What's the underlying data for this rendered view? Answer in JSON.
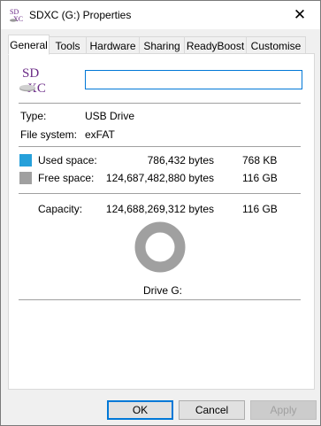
{
  "window": {
    "title": "SDXC (G:) Properties",
    "close_glyph": "✕",
    "title_icon": "sdxc-card-icon"
  },
  "tabs": [
    {
      "label": "General",
      "active": true
    },
    {
      "label": "Tools",
      "active": false
    },
    {
      "label": "Hardware",
      "active": false
    },
    {
      "label": "Sharing",
      "active": false
    },
    {
      "label": "ReadyBoost",
      "active": false
    },
    {
      "label": "Customise",
      "active": false
    }
  ],
  "drive": {
    "icon": "sdxc-drive-icon",
    "icon_text_top": "SD",
    "icon_text_bottom": "XC",
    "name_value": "",
    "type_label": "Type:",
    "type_value": "USB Drive",
    "fs_label": "File system:",
    "fs_value": "exFAT"
  },
  "usage": {
    "used_label": "Used space:",
    "used_bytes": "786,432 bytes",
    "used_size": "768 KB",
    "free_label": "Free space:",
    "free_bytes": "124,687,482,880 bytes",
    "free_size": "116 GB",
    "capacity_label": "Capacity:",
    "capacity_bytes": "124,688,269,312 bytes",
    "capacity_size": "116 GB",
    "used_fraction": 6.3e-06,
    "used_color": "#26a0da",
    "free_color": "#a0a0a0",
    "drive_label": "Drive G:"
  },
  "buttons": {
    "ok": "OK",
    "cancel": "Cancel",
    "apply": "Apply"
  }
}
